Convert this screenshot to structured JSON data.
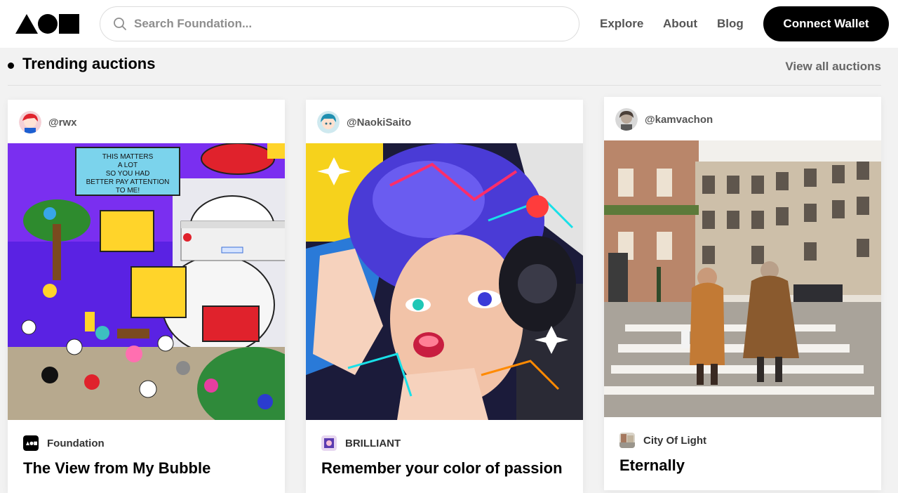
{
  "header": {
    "logo_icon": "foundation-logo",
    "search": {
      "placeholder": "Search Foundation...",
      "icon": "search-icon"
    },
    "nav": {
      "explore": "Explore",
      "about": "About",
      "blog": "Blog"
    },
    "connect_wallet": "Connect Wallet"
  },
  "section": {
    "title": "Trending auctions",
    "view_all": "View all auctions"
  },
  "cards": [
    {
      "creator": "@rwx",
      "artwork_label": "THIS MATTERS A LOT SO YOU HAD BETTER PAY ATTENTION TO ME!",
      "collection": "Foundation",
      "title": "The View from My Bubble"
    },
    {
      "creator": "@NaokiSaito",
      "collection": "BRILLIANT",
      "title": "Remember your color of passion"
    },
    {
      "creator": "@kamvachon",
      "collection": "City Of Light",
      "title": "Eternally"
    }
  ],
  "colors": {
    "accent": "#000000",
    "background": "#f2f2f2",
    "card": "#ffffff"
  }
}
